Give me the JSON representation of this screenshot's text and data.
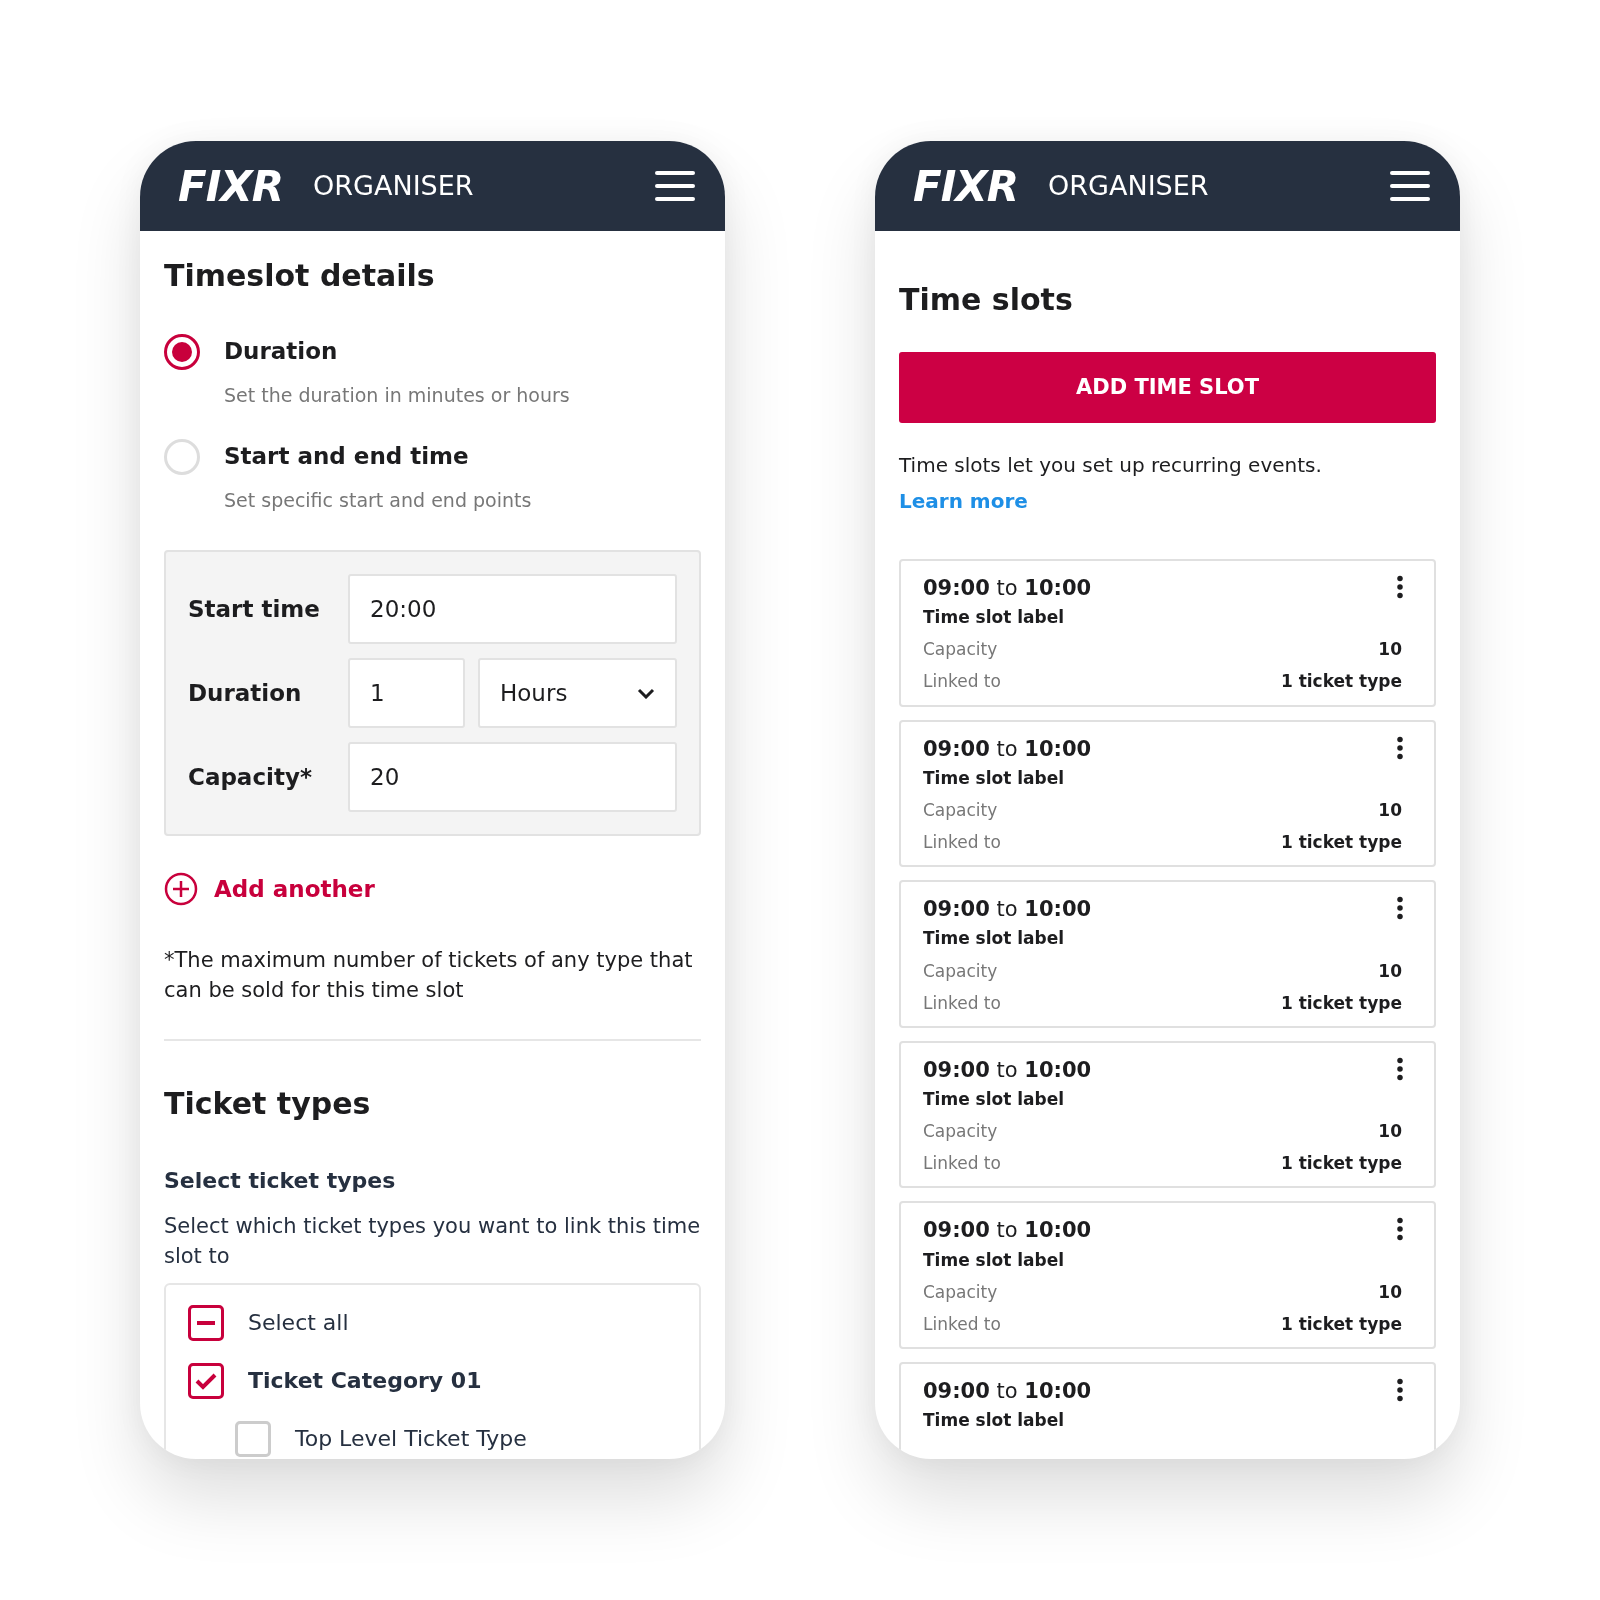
{
  "form_screen": {
    "header": {
      "logo": "FIXR",
      "title": "ORGANISER"
    },
    "heading": "Timeslot details",
    "options": [
      {
        "label": "Duration",
        "hint": "Set the duration in minutes or hours",
        "selected": true
      },
      {
        "label": "Start and end time",
        "hint": "Set specific start and end points",
        "selected": false
      }
    ],
    "fields": {
      "start_label": "Start time",
      "start_value": "20:00",
      "duration_label": "Duration",
      "duration_value": "1",
      "unit": "Hours",
      "capacity_label": "Capacity*",
      "capacity_value": "20"
    },
    "add_link": "Add another",
    "footnote": "*The maximum number of tickets of any type that can be sold for this time slot",
    "ticket_heading": "Ticket types",
    "select_heading": "Select ticket types",
    "select_desc": "Select which ticket types you want to link this time slot to",
    "ticket_options": [
      {
        "label": "Select all",
        "checked": true,
        "partial": true
      },
      {
        "label": "Ticket Category 01",
        "checked": true,
        "children": [
          {
            "label": "Top Level Ticket Type",
            "checked": false
          }
        ]
      }
    ]
  },
  "list_screen": {
    "header": {
      "logo": "FIXR",
      "title": "ORGANISER"
    },
    "heading": "Time slots",
    "add_button": "ADD TIME SLOT",
    "intro": "Time slots let you set up recurring events.",
    "intro_link": "Learn more",
    "slots": [
      {
        "time": "**09:00** to **10:00**",
        "label": "Time slot label",
        "capacity_label": "Capacity",
        "capacity": "10",
        "linked_label": "Linked to",
        "linked": "1 ticket type"
      },
      {
        "time": "**09:00** to **10:00**",
        "label": "Time slot label",
        "capacity_label": "Capacity",
        "capacity": "10",
        "linked_label": "Linked to",
        "linked": "1 ticket type"
      },
      {
        "time": "**09:00** to **10:00**",
        "label": "Time slot label",
        "capacity_label": "Capacity",
        "capacity": "10",
        "linked_label": "Linked to",
        "linked": "1 ticket type"
      },
      {
        "time": "**09:00** to **10:00**",
        "label": "Time slot label",
        "capacity_label": "Capacity",
        "capacity": "10",
        "linked_label": "Linked to",
        "linked": "1 ticket type"
      },
      {
        "time": "**09:00** to **10:00**",
        "label": "Time slot label",
        "capacity_label": "Capacity",
        "capacity": "10",
        "linked_label": "Linked to",
        "linked": "1 ticket type"
      },
      {
        "time": "**09:00** to **10:00**",
        "label": "Time slot label"
      }
    ]
  }
}
